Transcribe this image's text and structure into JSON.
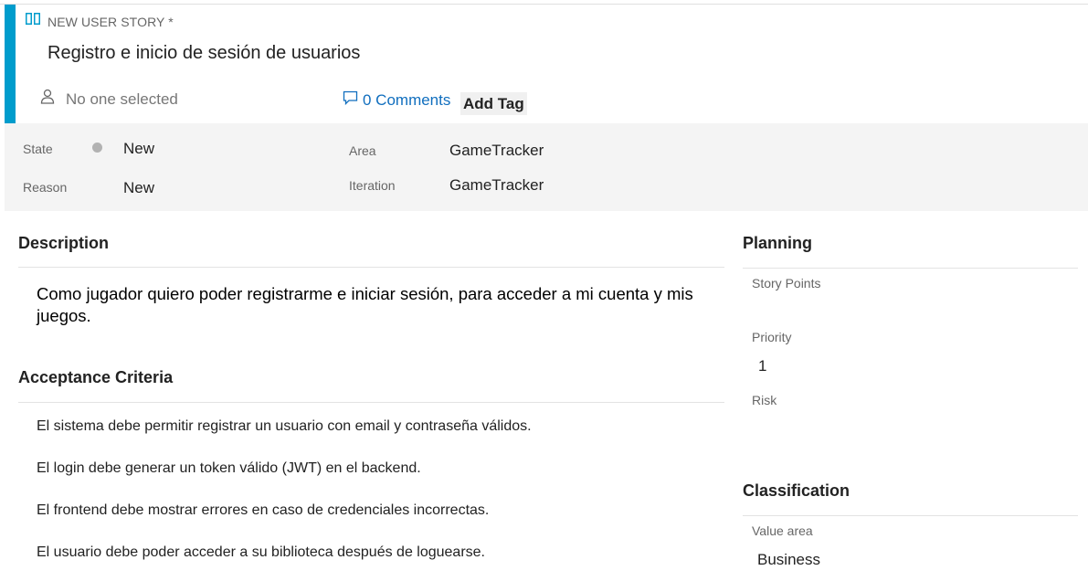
{
  "header": {
    "work_item_type": "NEW USER STORY *",
    "title": "Registro e inicio de sesión de usuarios",
    "assignee": "No one selected",
    "comments": "0 Comments",
    "add_tag": "Add Tag",
    "accent_color": "#009ccc"
  },
  "fields": {
    "state_label": "State",
    "state_value": "New",
    "reason_label": "Reason",
    "reason_value": "New",
    "area_label": "Area",
    "area_value": "GameTracker",
    "iteration_label": "Iteration",
    "iteration_value": "GameTracker"
  },
  "description": {
    "heading": "Description",
    "text": "Como jugador quiero poder registrarme e iniciar sesión, para acceder a mi cuenta y mis juegos."
  },
  "acceptance": {
    "heading": "Acceptance Criteria",
    "items": [
      "El sistema debe permitir registrar un usuario con email y contraseña válidos.",
      "El login debe generar un token válido (JWT) en el backend.",
      "El frontend debe mostrar errores en caso de credenciales incorrectas.",
      "El usuario debe poder acceder a su biblioteca después de loguearse."
    ]
  },
  "planning": {
    "heading": "Planning",
    "story_points_label": "Story Points",
    "story_points_value": "",
    "priority_label": "Priority",
    "priority_value": "1",
    "risk_label": "Risk",
    "risk_value": ""
  },
  "classification": {
    "heading": "Classification",
    "value_area_label": "Value area",
    "value_area_value": "Business"
  }
}
